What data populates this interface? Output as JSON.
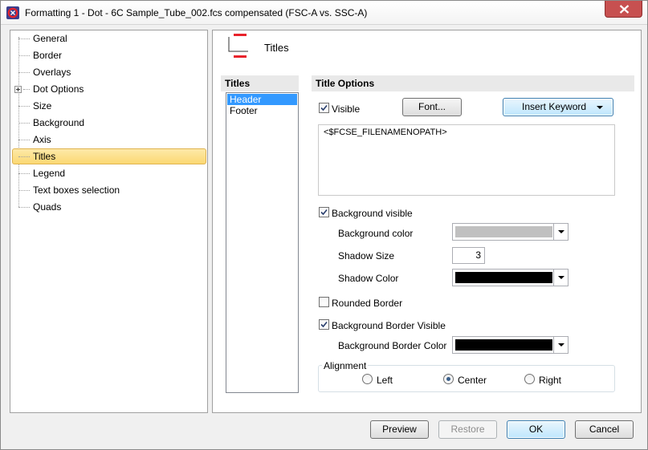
{
  "window": {
    "title": "Formatting 1 - Dot - 6C Sample_Tube_002.fcs compensated (FSC-A vs. SSC-A)",
    "icon": "fcs-express-logo-icon",
    "close_icon": "close-icon"
  },
  "sidebar": {
    "items": [
      {
        "label": "General"
      },
      {
        "label": "Border"
      },
      {
        "label": "Overlays"
      },
      {
        "label": "Dot Options",
        "expandable": true
      },
      {
        "label": "Size"
      },
      {
        "label": "Background"
      },
      {
        "label": "Axis"
      },
      {
        "label": "Titles",
        "selected": true
      },
      {
        "label": "Legend"
      },
      {
        "label": "Text boxes selection"
      },
      {
        "label": "Quads"
      }
    ]
  },
  "page": {
    "title": "Titles",
    "icon": "titles-icon"
  },
  "titles_list": {
    "header": "Titles",
    "items": [
      {
        "label": "Header",
        "selected": true
      },
      {
        "label": "Footer"
      }
    ]
  },
  "options": {
    "header": "Title Options",
    "visible_label": "Visible",
    "visible_checked": true,
    "font_button": "Font...",
    "insert_keyword_button": "Insert Keyword",
    "title_text": "<$FCSE_FILENAMENOPATH>",
    "background_visible_label": "Background visible",
    "background_visible_checked": true,
    "background_color_label": "Background color",
    "background_color": "#c0c0c0",
    "shadow_size_label": "Shadow Size",
    "shadow_size_value": "3",
    "shadow_color_label": "Shadow Color",
    "shadow_color": "#000000",
    "rounded_border_label": "Rounded Border",
    "rounded_border_checked": false,
    "bg_border_visible_label": "Background Border Visible",
    "bg_border_visible_checked": true,
    "bg_border_color_label": "Background Border Color",
    "bg_border_color": "#000000",
    "alignment": {
      "label": "Alignment",
      "options": [
        "Left",
        "Center",
        "Right"
      ],
      "selected": "Center"
    }
  },
  "footer": {
    "preview": "Preview",
    "restore": "Restore",
    "ok": "OK",
    "cancel": "Cancel"
  },
  "colors": {
    "accent_blue": "#3399ff",
    "selection_yellow": "#fbd872",
    "close_red": "#c75050",
    "icon_red": "#e8222b"
  }
}
